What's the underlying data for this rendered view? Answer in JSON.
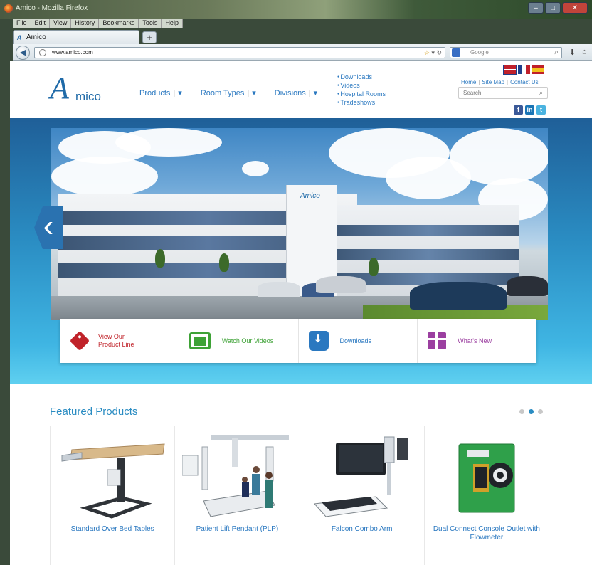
{
  "browser": {
    "window_title": "Amico - Mozilla Firefox",
    "menu": [
      "File",
      "Edit",
      "View",
      "History",
      "Bookmarks",
      "Tools",
      "Help"
    ],
    "tab_label": "Amico",
    "new_tab": "+",
    "url": "www.amico.com",
    "search_placeholder": "Google"
  },
  "header": {
    "logo_initial": "A",
    "logo_rest": "mico",
    "nav": [
      "Products",
      "Room Types",
      "Divisions"
    ],
    "quick_links": [
      "Downloads",
      "Videos",
      "Hospital Rooms",
      "Tradeshows"
    ],
    "top_links": [
      "Home",
      "Site Map",
      "Contact Us"
    ],
    "search_placeholder": "Search",
    "social": [
      "f",
      "in",
      "t"
    ]
  },
  "hero": {
    "building_sign": "Amico"
  },
  "cta": [
    {
      "label": "View Our Product Line",
      "icon": "tag-icon"
    },
    {
      "label": "Watch Our Videos",
      "icon": "tv-icon"
    },
    {
      "label": "Downloads",
      "icon": "download-icon"
    },
    {
      "label": "What's New",
      "icon": "gift-icon"
    }
  ],
  "featured": {
    "title": "Featured Products",
    "products": [
      {
        "name": "Standard Over Bed Tables"
      },
      {
        "name": "Patient Lift Pendant (PLP)"
      },
      {
        "name": "Falcon Combo Arm"
      },
      {
        "name": "Dual Connect Console Outlet with Flowmeter"
      }
    ]
  },
  "colors": {
    "brand_blue": "#2a78c0",
    "cta_red": "#c0232a",
    "cta_green": "#3ea236",
    "cta_purple": "#9b3fa0"
  }
}
